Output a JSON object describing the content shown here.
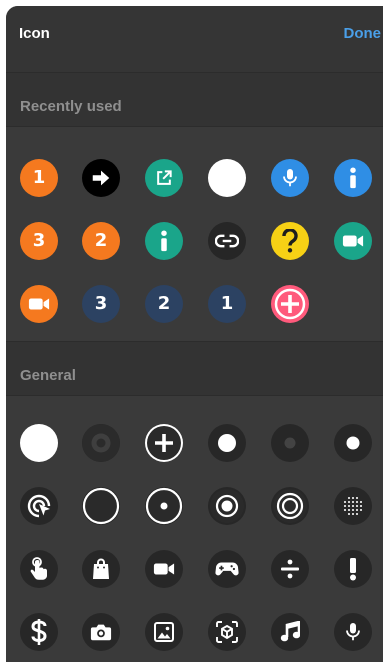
{
  "header": {
    "title": "Icon",
    "done_label": "Done"
  },
  "sections": {
    "recent": {
      "title": "Recently used"
    },
    "general": {
      "title": "General"
    }
  },
  "recent_icons": [
    {
      "name": "number-1-orange-icon",
      "text": "1",
      "bg": "#f5791f"
    },
    {
      "name": "arrow-right-icon",
      "bg": "#000000"
    },
    {
      "name": "external-link-icon",
      "bg": "#1aa58a"
    },
    {
      "name": "white-circle-icon",
      "bg": "#ffffff"
    },
    {
      "name": "microphone-blue-icon",
      "bg": "#2f8ee5"
    },
    {
      "name": "info-blue-icon",
      "bg": "#2f8ee5"
    },
    {
      "name": "number-3-orange-icon",
      "text": "3",
      "bg": "#f5791f"
    },
    {
      "name": "number-2-orange-icon",
      "text": "2",
      "bg": "#f5791f"
    },
    {
      "name": "info-teal-icon",
      "bg": "#1aa58a"
    },
    {
      "name": "link-icon",
      "bg": "#262626"
    },
    {
      "name": "question-icon",
      "bg": "#f7d115"
    },
    {
      "name": "video-camera-teal-icon",
      "bg": "#1aa58a"
    },
    {
      "name": "video-camera-orange-icon",
      "bg": "#f5791f"
    },
    {
      "name": "number-3-navy-icon",
      "text": "3",
      "bg": "#2c4262"
    },
    {
      "name": "number-2-navy-icon",
      "text": "2",
      "bg": "#2c4262"
    },
    {
      "name": "number-1-navy-icon",
      "text": "1",
      "bg": "#2c4262"
    },
    {
      "name": "plus-pink-icon",
      "bg": "#ff5a7c"
    }
  ],
  "general_icons": [
    {
      "name": "large-white-circle-icon",
      "bg": "#ffffff"
    },
    {
      "name": "dark-dot-circle-icon",
      "bg": "#272727"
    },
    {
      "name": "plus-circle-icon",
      "bg": "#ffffff"
    },
    {
      "name": "medium-white-dot-icon",
      "bg": "#272727"
    },
    {
      "name": "small-dark-dot-icon",
      "bg": "#272727"
    },
    {
      "name": "small-white-dot-icon",
      "bg": "#272727"
    },
    {
      "name": "cursor-click-icon",
      "bg": "#272727"
    },
    {
      "name": "outline-circle-icon",
      "bg": "#272727"
    },
    {
      "name": "radio-dot-icon",
      "bg": "#272727"
    },
    {
      "name": "filled-radio-icon",
      "bg": "#272727"
    },
    {
      "name": "concentric-circles-icon",
      "bg": "#272727"
    },
    {
      "name": "dotted-grid-circle-icon",
      "bg": "#272727"
    },
    {
      "name": "tap-hand-icon",
      "bg": "#272727"
    },
    {
      "name": "shopping-bag-icon",
      "bg": "#272727"
    },
    {
      "name": "video-camera-icon",
      "bg": "#272727"
    },
    {
      "name": "gamepad-icon",
      "bg": "#272727"
    },
    {
      "name": "divide-icon",
      "bg": "#272727"
    },
    {
      "name": "exclamation-icon",
      "bg": "#272727"
    },
    {
      "name": "dollar-icon",
      "bg": "#272727"
    },
    {
      "name": "camera-icon",
      "bg": "#272727"
    },
    {
      "name": "image-icon",
      "bg": "#272727"
    },
    {
      "name": "ar-cube-icon",
      "bg": "#272727"
    },
    {
      "name": "music-note-icon",
      "bg": "#272727"
    },
    {
      "name": "microphone-icon",
      "bg": "#272727"
    }
  ]
}
